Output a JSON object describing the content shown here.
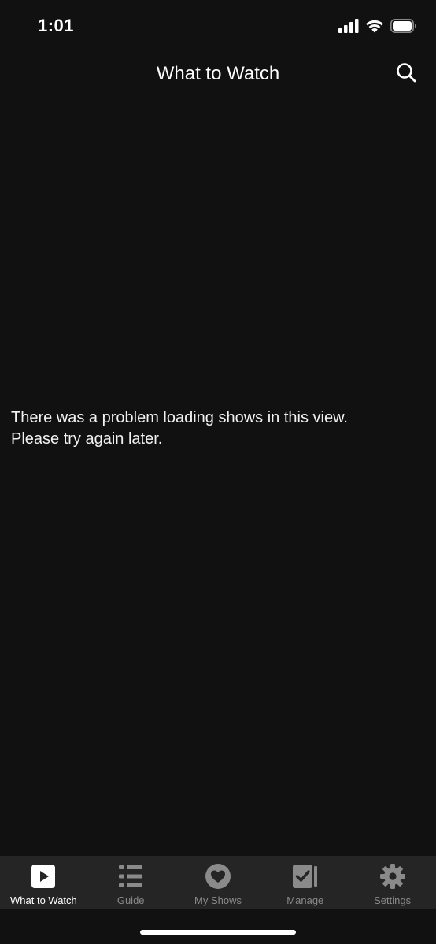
{
  "status_bar": {
    "time": "1:01",
    "icons": [
      "cellular-signal-icon",
      "wifi-icon",
      "battery-icon"
    ]
  },
  "header": {
    "title": "What to Watch",
    "search_icon": "search-icon"
  },
  "message": {
    "line1": "There was a problem loading shows in this view.",
    "line2": "Please try again later."
  },
  "tab_bar": {
    "active_color": "#ffffff",
    "inactive_color": "#8a8a8a",
    "tabs": [
      {
        "label": "What to Watch",
        "icon": "play-icon",
        "active": true
      },
      {
        "label": "Guide",
        "icon": "list-icon",
        "active": false
      },
      {
        "label": "My Shows",
        "icon": "heart-icon",
        "active": false
      },
      {
        "label": "Manage",
        "icon": "checkbox-icon",
        "active": false
      },
      {
        "label": "Settings",
        "icon": "gear-icon",
        "active": false
      }
    ]
  }
}
